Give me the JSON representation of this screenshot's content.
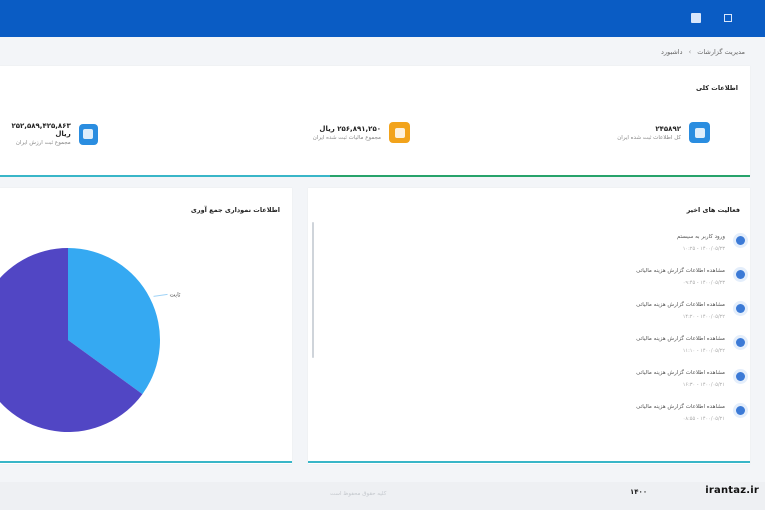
{
  "header": {
    "icons": [
      "grid-icon",
      "square-icon"
    ]
  },
  "breadcrumb": {
    "items": [
      "داشبورد",
      "›",
      "مدیریت گزارشات"
    ]
  },
  "summary": {
    "title": "اطلاعات کلی",
    "stats": [
      {
        "value": "۲۴۵۸۹۲",
        "label": "کل اطلاعات ثبت شده ایران",
        "color": "#2a8de0",
        "icon": "document-icon"
      },
      {
        "value": "۲۵۶,۸۹۱,۲۵۰ ریال",
        "label": "مجموع مالیات ثبت شده ایران",
        "color": "#f2a31b",
        "icon": "money-icon"
      },
      {
        "value": "۲۵۲,۵۸۹,۴۲۵,۸۶۳ ریال",
        "label": "مجموع ثبت ارزش ایران",
        "color": "#2a8de0",
        "icon": "chart-icon"
      }
    ]
  },
  "activity": {
    "title": "فعالیت های اخیر",
    "items": [
      {
        "text": "ورود کاربر به سیستم",
        "time": "۱۴۰۰/۰۵/۲۳ - ۱۰:۲۵"
      },
      {
        "text": "مشاهده اطلاعات گزارش هزینه مالیاتی",
        "time": "۱۴۰۰/۰۵/۲۳ - ۰۹:۴۵"
      },
      {
        "text": "مشاهده اطلاعات گزارش هزینه مالیاتی",
        "time": "۱۴۰۰/۰۵/۲۲ - ۱۴:۲۰"
      },
      {
        "text": "مشاهده اطلاعات گزارش هزینه مالیاتی",
        "time": "۱۴۰۰/۰۵/۲۲ - ۱۱:۱۰"
      },
      {
        "text": "مشاهده اطلاعات گزارش هزینه مالیاتی",
        "time": "۱۴۰۰/۰۵/۲۱ - ۱۶:۳۰"
      },
      {
        "text": "مشاهده اطلاعات گزارش هزینه مالیاتی",
        "time": "۱۴۰۰/۰۵/۲۱ - ۰۸:۵۵"
      }
    ]
  },
  "chart_panel": {
    "title": "اطلاعات نموداری جمع آوری"
  },
  "chart_data": {
    "type": "pie",
    "slices": [
      {
        "name": "ثابت",
        "value": 35,
        "color": "#35a9f2"
      },
      {
        "name": "",
        "value": 65,
        "color": "#5146c4"
      }
    ],
    "legend_label": "ثابت"
  },
  "footer": {
    "text": "کلیه حقوق محفوظ است",
    "left_mark": "۱۴۰۰",
    "watermark": "irantaz.ir"
  }
}
